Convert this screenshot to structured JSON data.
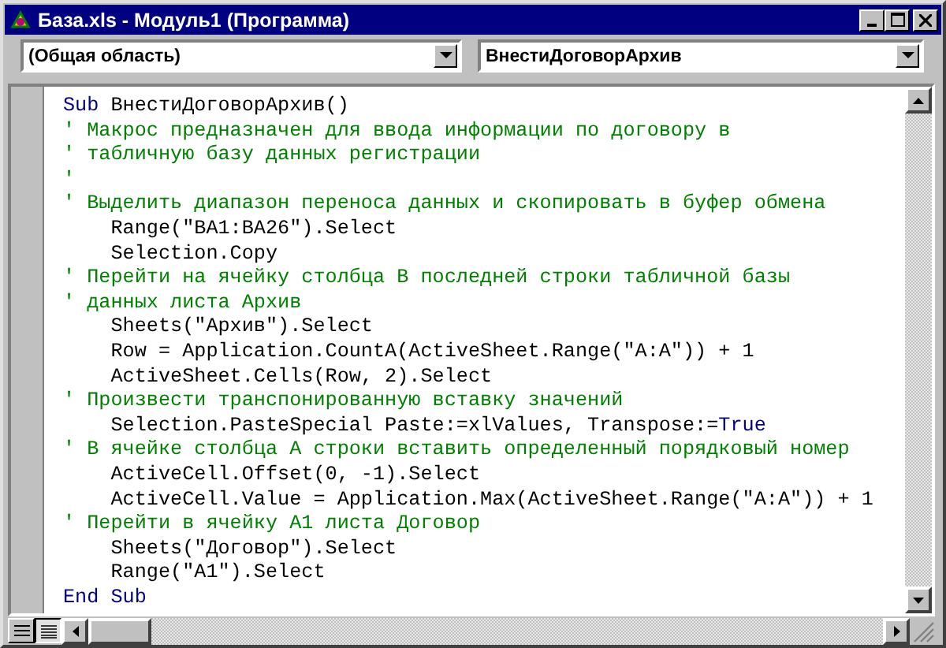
{
  "window": {
    "title": "База.xls - Модуль1 (Программа)"
  },
  "object_dropdown": {
    "value": "(Общая область)"
  },
  "procedure_dropdown": {
    "value": "ВнестиДоговорАрхив"
  },
  "code_lines": [
    [
      {
        "kind": "keyword",
        "text": "Sub"
      },
      {
        "kind": "code",
        "text": " ВнестиДоговорАрхив()"
      }
    ],
    [
      {
        "kind": "comment",
        "text": "' Макрос предназначен для ввода информации по договору в"
      }
    ],
    [
      {
        "kind": "comment",
        "text": "' табличную базу данных регистрации"
      }
    ],
    [
      {
        "kind": "comment",
        "text": "'"
      }
    ],
    [
      {
        "kind": "comment",
        "text": "' Выделить диапазон переноса данных и скопировать в буфер обмена"
      }
    ],
    [
      {
        "kind": "code",
        "text": "    Range(\"BA1:BA26\").Select"
      }
    ],
    [
      {
        "kind": "code",
        "text": "    Selection.Copy"
      }
    ],
    [
      {
        "kind": "comment",
        "text": "' Перейти на ячейку столбца В последней строки табличной базы"
      }
    ],
    [
      {
        "kind": "comment",
        "text": "' данных листа Архив"
      }
    ],
    [
      {
        "kind": "code",
        "text": "    Sheets(\"Архив\").Select"
      }
    ],
    [
      {
        "kind": "code",
        "text": "    Row = Application.CountA(ActiveSheet.Range(\"A:A\")) + 1"
      }
    ],
    [
      {
        "kind": "code",
        "text": "    ActiveSheet.Cells(Row, 2).Select"
      }
    ],
    [
      {
        "kind": "comment",
        "text": "' Произвести транспонированную вставку значений"
      }
    ],
    [
      {
        "kind": "code",
        "text": "    Selection.PasteSpecial Paste:=xlValues, Transpose:="
      },
      {
        "kind": "keyword",
        "text": "True"
      }
    ],
    [
      {
        "kind": "comment",
        "text": "' В ячейке столбца А строки вставить определенный порядковый номер"
      }
    ],
    [
      {
        "kind": "code",
        "text": "    ActiveCell.Offset(0, -1).Select"
      }
    ],
    [
      {
        "kind": "code",
        "text": "    ActiveCell.Value = Application.Max(ActiveSheet.Range(\"A:A\")) + 1"
      }
    ],
    [
      {
        "kind": "comment",
        "text": "' Перейти в ячейку А1 листа Договор"
      }
    ],
    [
      {
        "kind": "code",
        "text": "    Sheets(\"Договор\").Select"
      }
    ],
    [
      {
        "kind": "code",
        "text": "    Range(\"A1\").Select"
      }
    ],
    [
      {
        "kind": "keyword",
        "text": "End Sub"
      }
    ]
  ]
}
